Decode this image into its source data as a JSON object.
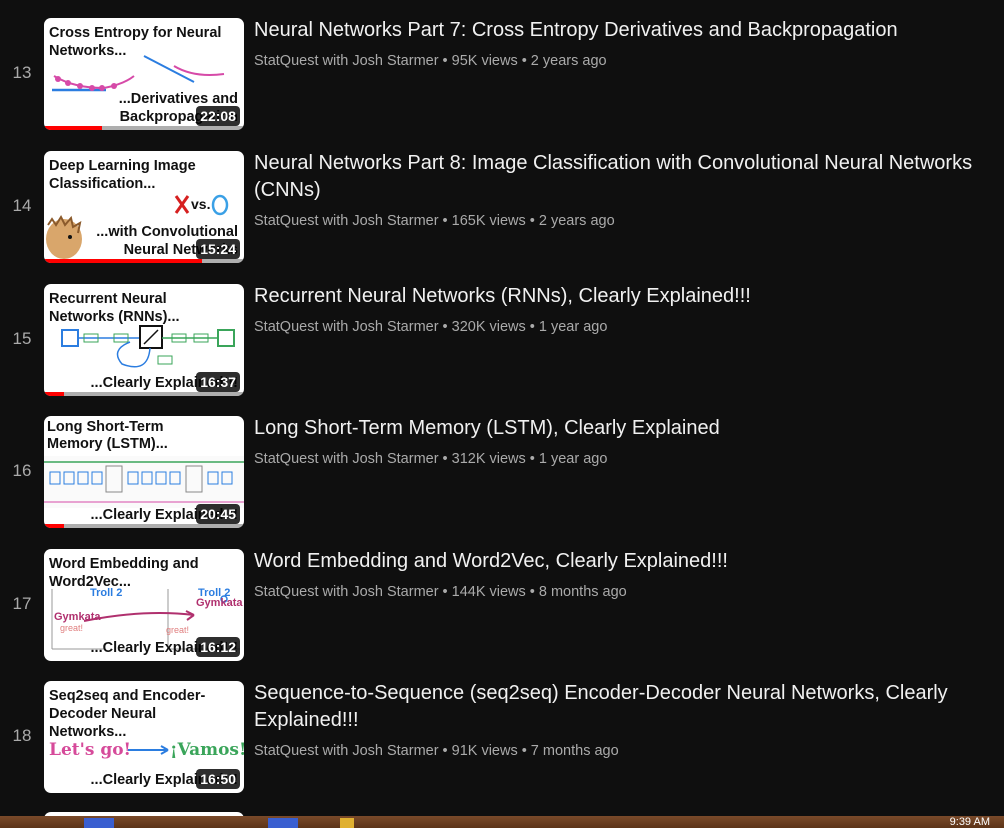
{
  "videos": [
    {
      "index": "13",
      "title": "Neural Networks Part 7: Cross Entropy Derivatives and Backpropagation",
      "channel": "StatQuest with Josh Starmer",
      "views": "95K views",
      "age": "2 years ago",
      "duration": "22:08",
      "thumb_title": "Cross Entropy for Neural Networks...",
      "thumb_sub": "...Derivatives and Backpropagation",
      "watch_progress": 0.29
    },
    {
      "index": "14",
      "title": "Neural Networks Part 8: Image Classification with Convolutional Neural Networks (CNNs)",
      "channel": "StatQuest with Josh Starmer",
      "views": "165K views",
      "age": "2 years ago",
      "duration": "15:24",
      "thumb_title": "Deep Learning Image Classification...",
      "thumb_sub": "...with Convolutional Neural Networks",
      "thumb_vs": "vs.",
      "watch_progress": 0.79
    },
    {
      "index": "15",
      "title": "Recurrent Neural Networks (RNNs), Clearly Explained!!!",
      "channel": "StatQuest with Josh Starmer",
      "views": "320K views",
      "age": "1 year ago",
      "duration": "16:37",
      "thumb_title": "Recurrent Neural Networks (RNNs)...",
      "thumb_sub": "...Clearly Explained!!!",
      "watch_progress": 0.1
    },
    {
      "index": "16",
      "title": "Long Short-Term Memory (LSTM), Clearly Explained",
      "channel": "StatQuest with Josh Starmer",
      "views": "312K views",
      "age": "1 year ago",
      "duration": "20:45",
      "thumb_title": "Long Short-Term Memory (LSTM)...",
      "thumb_sub": "...Clearly Explained!!!",
      "watch_progress": 0.1
    },
    {
      "index": "17",
      "title": "Word Embedding and Word2Vec, Clearly Explained!!!",
      "channel": "StatQuest with Josh Starmer",
      "views": "144K views",
      "age": "8 months ago",
      "duration": "16:12",
      "thumb_title": "Word Embedding and Word2Vec...",
      "thumb_sub": "...Clearly Explained!!!",
      "thumb_troll_left": "Troll 2",
      "thumb_troll_right": "Troll 2",
      "thumb_gym_left": "Gymkata",
      "thumb_gym_right": "Gymkata",
      "thumb_great": "great!",
      "watch_progress": 0
    },
    {
      "index": "18",
      "title": "Sequence-to-Sequence (seq2seq) Encoder-Decoder Neural Networks, Clearly Explained!!!",
      "channel": "StatQuest with Josh Starmer",
      "views": "91K views",
      "age": "7 months ago",
      "duration": "16:50",
      "thumb_title": "Seq2seq and Encoder-Decoder Neural Networks...",
      "thumb_sub": "...Clearly Explained!!!",
      "thumb_left_phrase": "Let's go!",
      "thumb_right_phrase": "¡Vamos!",
      "watch_progress": 0
    }
  ],
  "separator": "•",
  "taskbar": {
    "clock": "9:39 AM"
  },
  "colors": {
    "background": "#0f0f0f",
    "progress": "#ff0000",
    "meta_text": "#aaaaaa",
    "title_text": "#f1f1f1"
  }
}
